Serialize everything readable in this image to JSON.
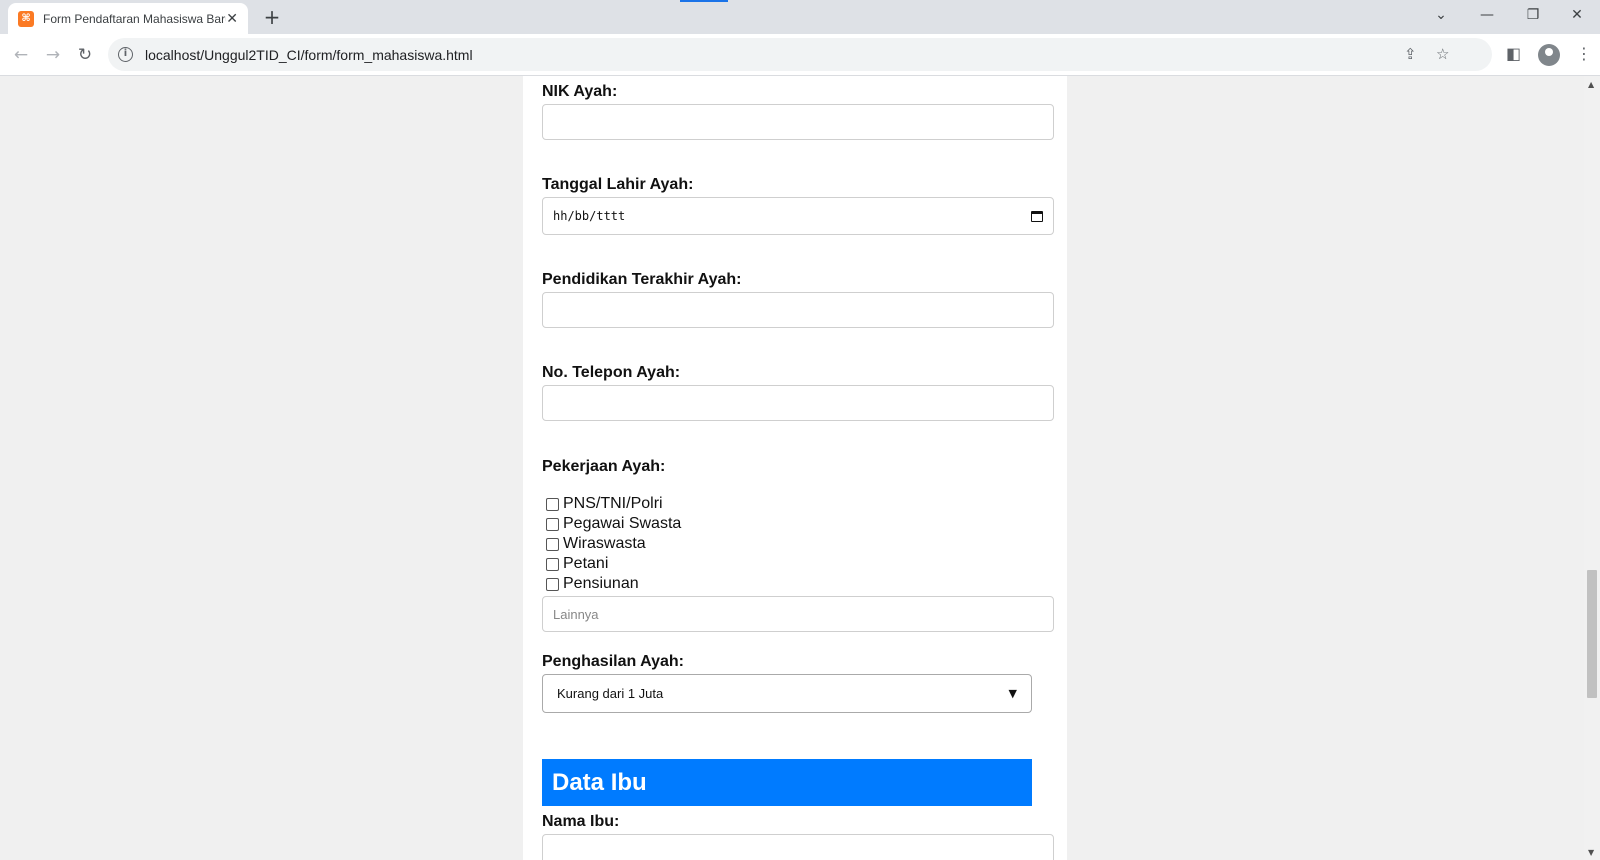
{
  "browser": {
    "tab_title": "Form Pendaftaran Mahasiswa Baru",
    "tab_favicon": "xampp-icon",
    "close_tab_glyph": "✕",
    "new_tab_glyph": "+",
    "url": "localhost/Unggul2TID_CI/form/form_mahasiswa.html",
    "window_controls": {
      "tab_search": "⌄",
      "minimize": "—",
      "restore": "❐",
      "close": "✕"
    },
    "nav": {
      "back": "←",
      "forward": "→",
      "reload": "↻"
    }
  },
  "form": {
    "nik_ayah_label": "NIK Ayah:",
    "tanggal_lahir_ayah_label": "Tanggal Lahir Ayah:",
    "tanggal_lahir_ayah_placeholder": "hh/bb/tttt",
    "pendidikan_ayah_label": "Pendidikan Terakhir Ayah:",
    "telepon_ayah_label": "No. Telepon Ayah:",
    "pekerjaan_ayah_label": "Pekerjaan Ayah:",
    "pekerjaan_options": [
      {
        "label": "PNS/TNI/Polri",
        "checked": false
      },
      {
        "label": "Pegawai Swasta",
        "checked": false
      },
      {
        "label": "Wiraswasta",
        "checked": false
      },
      {
        "label": "Petani",
        "checked": false
      },
      {
        "label": "Pensiunan",
        "checked": false
      }
    ],
    "pekerjaan_lainnya_placeholder": "Lainnya",
    "penghasilan_ayah_label": "Penghasilan Ayah:",
    "penghasilan_ayah_selected": "Kurang dari 1 Juta",
    "section_data_ibu": "Data Ibu",
    "nama_ibu_label": "Nama Ibu:"
  },
  "colors": {
    "accent": "#007bff",
    "tab_strip": "#dee1e6",
    "page_bg": "#f0f0f0"
  }
}
